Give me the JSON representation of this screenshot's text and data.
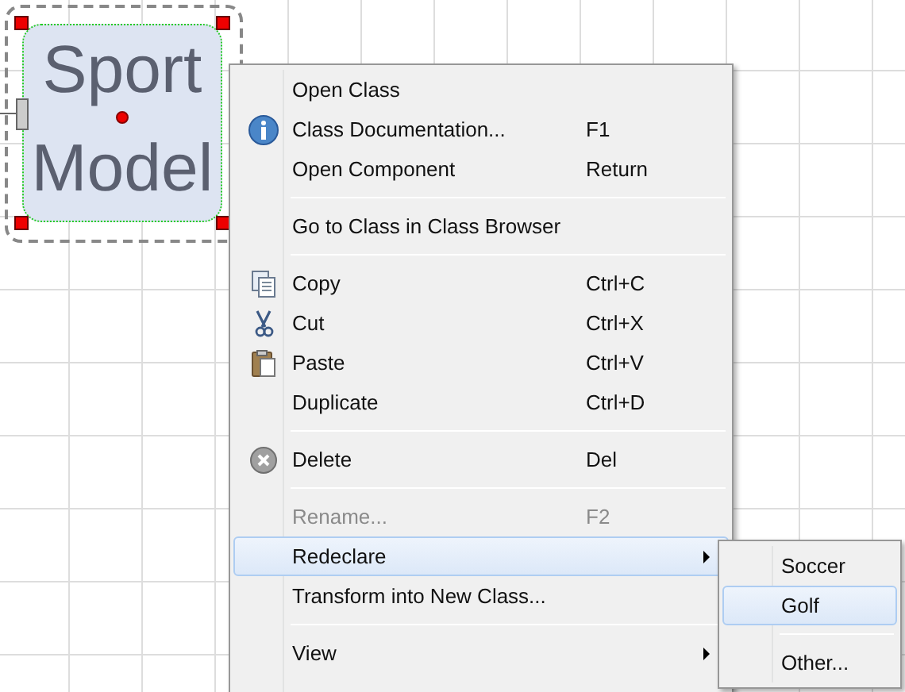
{
  "component": {
    "label_lines": [
      "Sport",
      "Model"
    ],
    "selected": true
  },
  "context_menu": {
    "items": [
      {
        "kind": "item",
        "label": "Open Class",
        "disabled": false,
        "selected": false
      },
      {
        "kind": "item",
        "label": "Class Documentation...",
        "shortcut": "F1",
        "disabled": false,
        "selected": false
      },
      {
        "kind": "item",
        "label": "Open Component",
        "shortcut": "Return",
        "disabled": false,
        "selected": false
      },
      {
        "kind": "separator"
      },
      {
        "kind": "item",
        "label": "Go to Class in Class Browser",
        "disabled": false,
        "selected": false
      },
      {
        "kind": "separator"
      },
      {
        "kind": "item",
        "label": "Copy",
        "shortcut": "Ctrl+C",
        "disabled": false,
        "selected": false
      },
      {
        "kind": "item",
        "label": "Cut",
        "shortcut": "Ctrl+X",
        "disabled": false,
        "selected": false
      },
      {
        "kind": "item",
        "label": "Paste",
        "shortcut": "Ctrl+V",
        "disabled": false,
        "selected": false
      },
      {
        "kind": "item",
        "label": "Duplicate",
        "shortcut": "Ctrl+D",
        "disabled": false,
        "selected": false
      },
      {
        "kind": "separator"
      },
      {
        "kind": "item",
        "label": "Delete",
        "shortcut": "Del",
        "disabled": false,
        "selected": false
      },
      {
        "kind": "separator"
      },
      {
        "kind": "item",
        "label": "Rename...",
        "shortcut": "F2",
        "disabled": true,
        "selected": false
      },
      {
        "kind": "submenu",
        "label": "Redeclare",
        "disabled": false,
        "selected": true
      },
      {
        "kind": "item",
        "label": "Transform into New Class...",
        "disabled": false,
        "selected": false
      },
      {
        "kind": "separator"
      },
      {
        "kind": "submenu",
        "label": "View",
        "disabled": false,
        "selected": false
      }
    ]
  },
  "submenu": {
    "items": [
      {
        "kind": "item",
        "label": "Soccer",
        "selected": false
      },
      {
        "kind": "item",
        "label": "Golf",
        "selected": true
      },
      {
        "kind": "separator"
      },
      {
        "kind": "item",
        "label": "Other...",
        "selected": false
      }
    ]
  }
}
